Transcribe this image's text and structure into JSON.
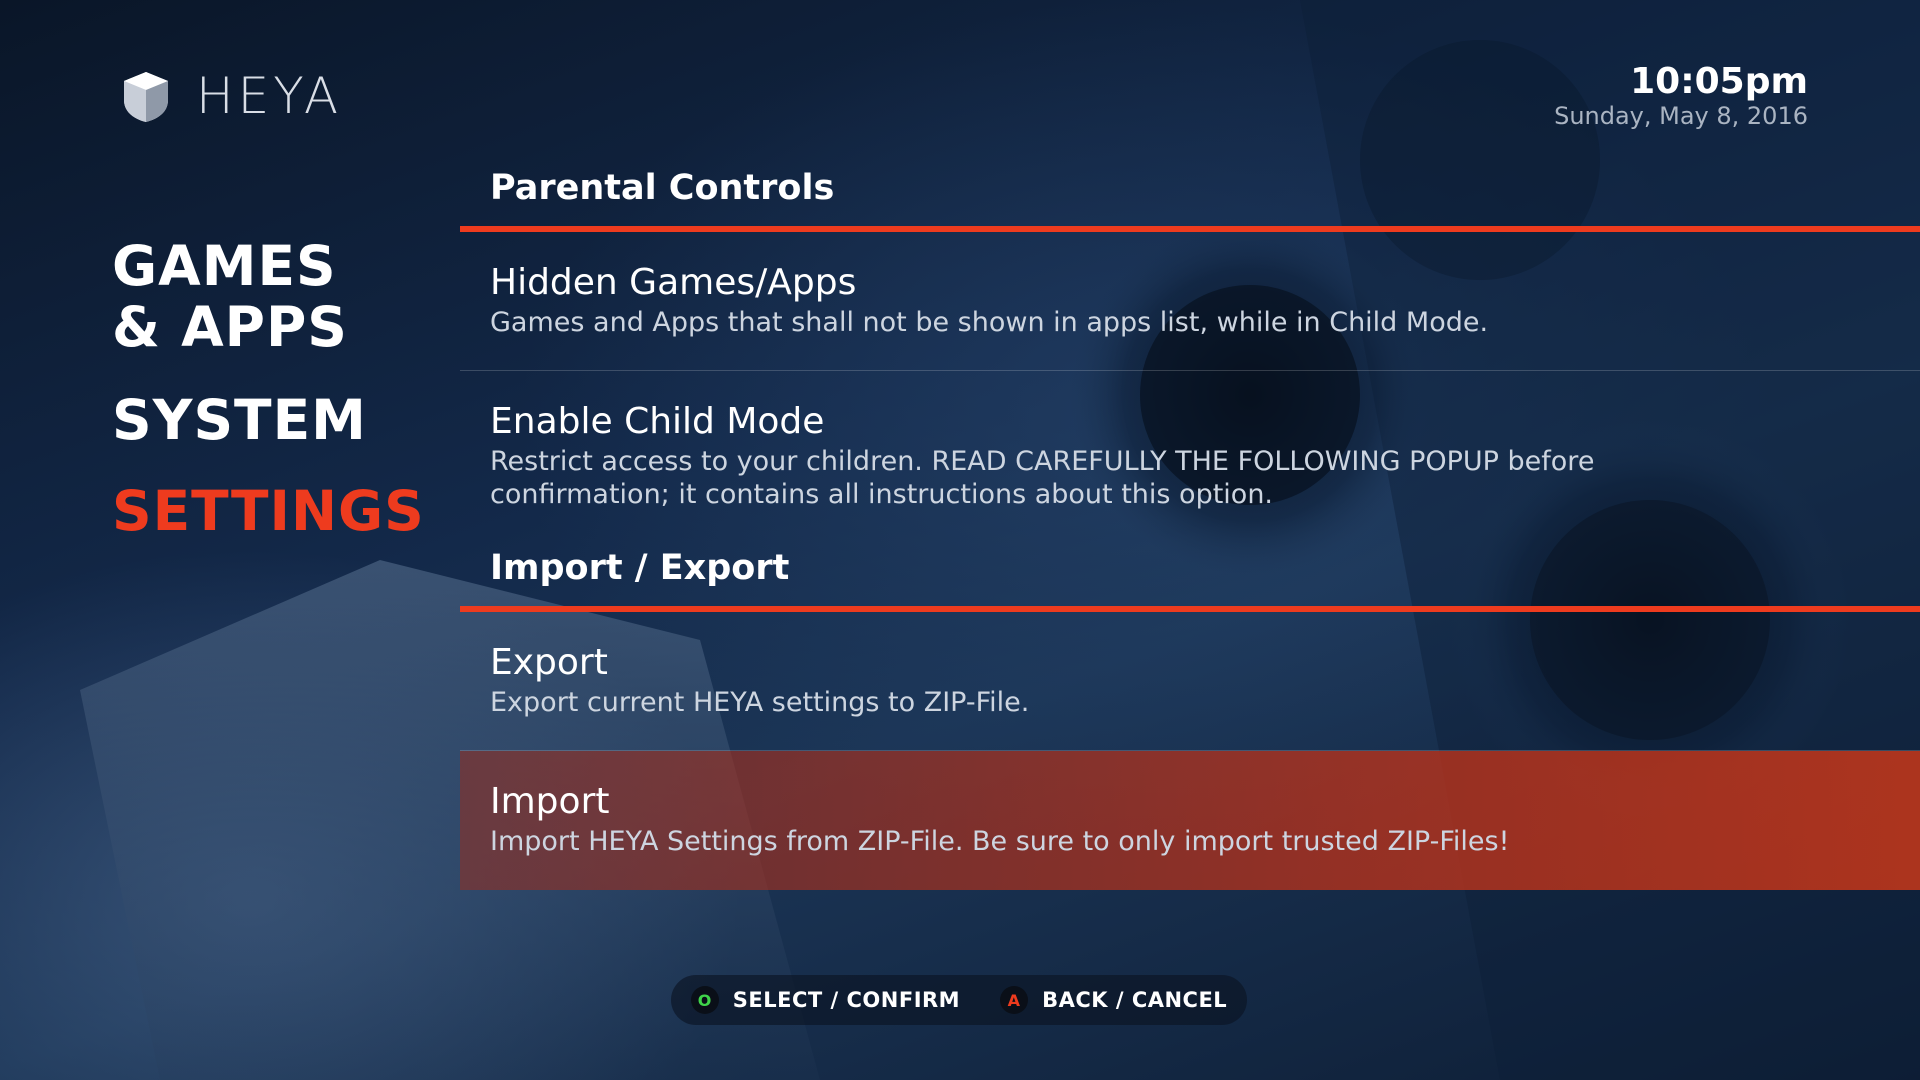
{
  "brand": {
    "name": "HEYA",
    "logo_icon": "cube-shield-icon"
  },
  "clock": {
    "time": "10:05pm",
    "date": "Sunday, May 8, 2016"
  },
  "nav": {
    "items": [
      {
        "label_line1": "GAMES",
        "label_line2": "& APPS"
      },
      {
        "label": "SYSTEM"
      },
      {
        "label": "SETTINGS",
        "active": true
      }
    ]
  },
  "sections": [
    {
      "title": "Parental Controls",
      "items": [
        {
          "title": "Hidden Games/Apps",
          "description": "Games and Apps that shall not be shown in apps list, while in Child Mode."
        },
        {
          "title": "Enable Child Mode",
          "description": "Restrict access to your children. READ CAREFULLY THE FOLLOWING POPUP before confirmation; it contains all instructions about this option."
        }
      ]
    },
    {
      "title": "Import / Export",
      "items": [
        {
          "title": "Export",
          "description": "Export current HEYA settings to ZIP-File."
        },
        {
          "title": "Import",
          "description": "Import HEYA Settings from ZIP-File. Be sure to only import trusted ZIP-Files!",
          "selected": true
        }
      ]
    }
  ],
  "hints": {
    "select": {
      "button": "O",
      "label": "SELECT / CONFIRM",
      "icon": "o-button-icon"
    },
    "back": {
      "button": "A",
      "label": "BACK / CANCEL",
      "icon": "a-button-icon"
    }
  },
  "colors": {
    "accent": "#ee3b1e",
    "background": "#0c1a2e",
    "confirm_green": "#3fd44a"
  }
}
